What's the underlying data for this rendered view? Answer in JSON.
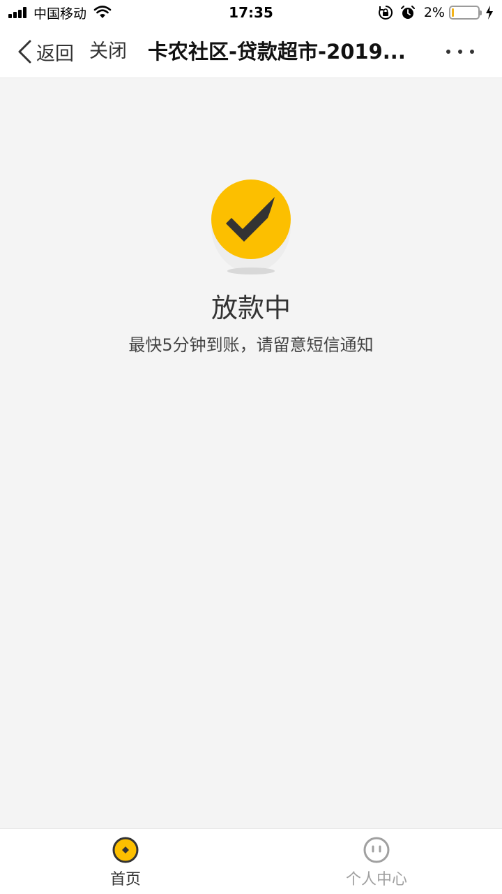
{
  "status_bar": {
    "carrier": "中国移动",
    "time": "17:35",
    "battery_text": "2%",
    "battery_level": 0.02,
    "battery_color": "#f3b319",
    "icons": [
      "signal-icon",
      "wifi-icon",
      "orientation-lock-icon",
      "alarm-icon",
      "battery-icon",
      "charging-bolt-icon"
    ]
  },
  "nav": {
    "back_label": "返回",
    "close_label": "关闭",
    "title": "卡农社区-贷款超市-2019...",
    "more_icon": "more-dots-icon"
  },
  "main": {
    "icon": "checkmark-circle-icon",
    "accent_color": "#fcbf00",
    "status_title": "放款中",
    "status_desc": "最快5分钟到账，请留意短信通知"
  },
  "tabs": [
    {
      "label": "首页",
      "icon": "home-coin-icon",
      "active": true
    },
    {
      "label": "个人中心",
      "icon": "profile-face-icon",
      "active": false
    }
  ]
}
